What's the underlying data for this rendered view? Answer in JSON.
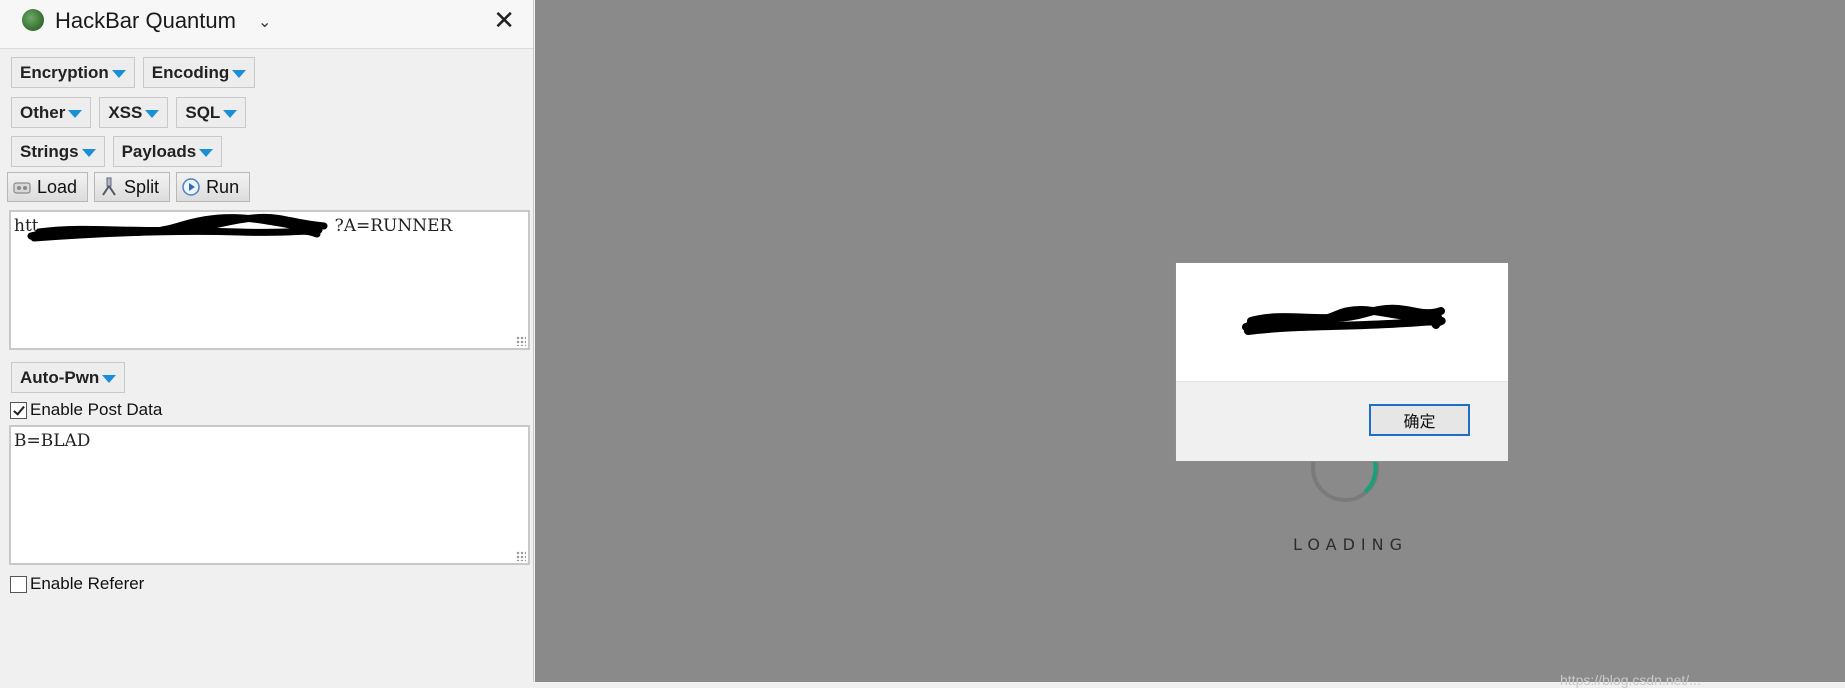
{
  "sidebar": {
    "title": "HackBar Quantum",
    "menus_row1": [
      "Encryption",
      "Encoding"
    ],
    "menus_row2": [
      "Other",
      "XSS",
      "SQL"
    ],
    "menus_row3": [
      "Strings",
      "Payloads"
    ],
    "actions": {
      "load": "Load",
      "split": "Split",
      "run": "Run"
    },
    "url_value": "http://[redacted]?A=RUNNER",
    "url_visible_suffix": "?A=RUNNER",
    "url_visible_prefix": "htt",
    "autopwn_label": "Auto-Pwn",
    "enable_post_label": "Enable Post Data",
    "enable_post_checked": true,
    "post_data_value": "B=BLAD",
    "enable_referer_label": "Enable Referer",
    "enable_referer_checked": false
  },
  "main": {
    "loading_text": "LOADING",
    "footer_url": "https://blog.csdn.net/..."
  },
  "dialog": {
    "ok_label": "确定"
  },
  "colors": {
    "caret": "#1b8fd6",
    "page_bg": "#8a8a8a",
    "loader_accent": "#18a07a",
    "ok_border": "#1c6fc4"
  }
}
